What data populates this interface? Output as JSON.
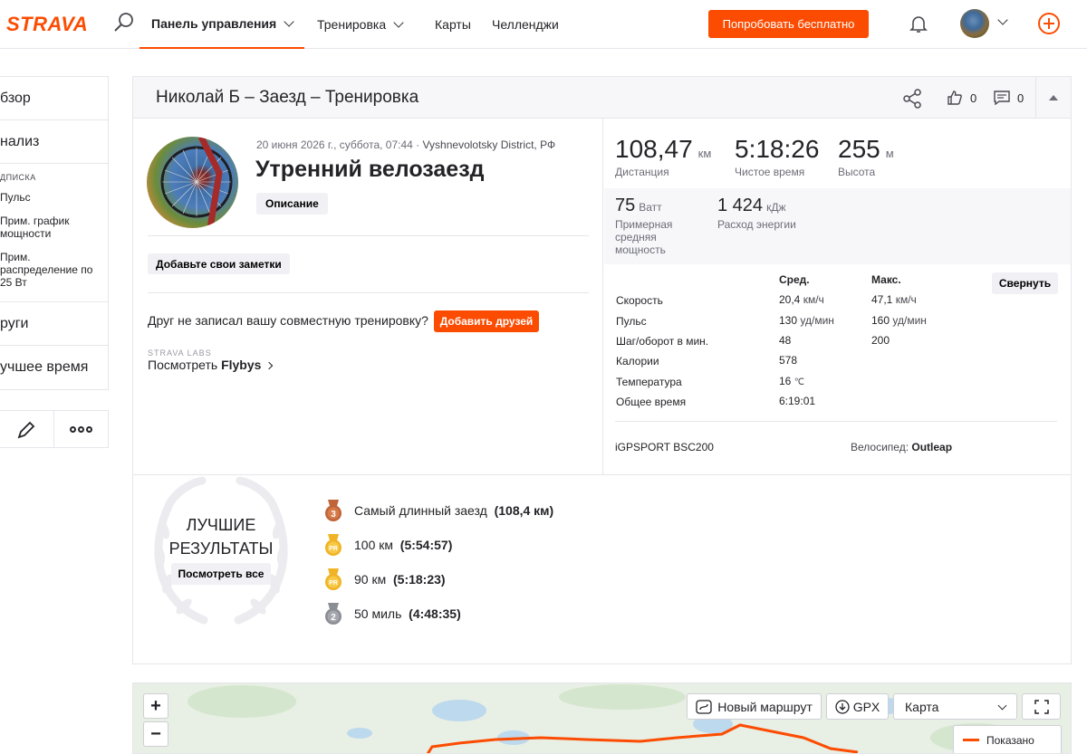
{
  "topbar": {
    "logo": "STRAVA",
    "nav": {
      "dashboard": "Панель управления",
      "training": "Тренировка",
      "maps": "Карты",
      "challenges": "Челленджи"
    },
    "try_free": "Попробовать бесплатно",
    "accent_color": "#fc4c02"
  },
  "sidebar": {
    "overview": "бзор",
    "analysis": "нализ",
    "subscription_header": "ДПИСКА",
    "sub_items": [
      "Пульс",
      "Прим. график мощности",
      "Прим. распределение по 25 Вт"
    ],
    "others": "руги",
    "best_efforts": "учшее время"
  },
  "header": {
    "title": "Николай Б – Заезд – Тренировка",
    "likes": "0",
    "comments": "0"
  },
  "activity": {
    "date_loc": "20 июня 2026 г., суббота, 07:44 · ",
    "location": "Vyshnevolotsky District, РФ",
    "name": "Утренний велозаезд",
    "description_btn": "Описание",
    "notes_btn": "Добавьте свои заметки",
    "friend_question": "Друг не записал вашу совместную тренировку?",
    "add_friends_btn": "Добавить друзей",
    "labs": "STRAVA LABS",
    "flybys_prefix": "Посмотреть ",
    "flybys": "Flybys"
  },
  "stats": {
    "distance": {
      "value": "108,47",
      "unit": "км",
      "label": "Дистанция"
    },
    "moving_time": {
      "value": "5:18:26",
      "label": "Чистое время"
    },
    "elevation": {
      "value": "255",
      "unit": "м",
      "label": "Высота"
    },
    "power": {
      "value": "75",
      "unit": "Ватт",
      "label": "Примерная средняя мощность"
    },
    "energy": {
      "value": "1 424",
      "unit": "кДж",
      "label": "Расход энергии"
    }
  },
  "details": {
    "avg_header": "Сред.",
    "max_header": "Макс.",
    "collapse_btn": "Свернуть",
    "rows": [
      {
        "label": "Скорость",
        "avg": "20,4",
        "avg_unit": "км/ч",
        "max": "47,1",
        "max_unit": "км/ч"
      },
      {
        "label": "Пульс",
        "avg": "130",
        "avg_unit": "уд/мин",
        "max": "160",
        "max_unit": "уд/мин"
      },
      {
        "label": "Шаг/оборот в мин.",
        "avg": "48",
        "avg_unit": "",
        "max": "200",
        "max_unit": ""
      },
      {
        "label": "Калории",
        "avg": "578",
        "avg_unit": "",
        "max": "",
        "max_unit": ""
      },
      {
        "label": "Температура",
        "avg": "16",
        "avg_unit": "℃",
        "max": "",
        "max_unit": ""
      },
      {
        "label": "Общее время",
        "avg": "6:19:01",
        "avg_unit": "",
        "max": "",
        "max_unit": ""
      }
    ],
    "device": "iGPSPORT BSC200",
    "bike_label": "Велосипед: ",
    "bike_name": "Outleap"
  },
  "achievements": {
    "title_line1": "ЛУЧШИЕ",
    "title_line2": "РЕЗУЛЬТАТЫ",
    "see_all": "Посмотреть все",
    "items": [
      {
        "medal": "3",
        "text": "Самый длинный заезд",
        "value": "(108,4 км)",
        "color": "#c0643a"
      },
      {
        "medal": "PR",
        "text": "100 км",
        "value": "(5:54:57)",
        "color": "#f0b323"
      },
      {
        "medal": "PR",
        "text": "90 км",
        "value": "(5:18:23)",
        "color": "#f0b323"
      },
      {
        "medal": "2",
        "text": "50 миль",
        "value": "(4:48:35)",
        "color": "#8a8d93"
      }
    ]
  },
  "map": {
    "zoom_in": "+",
    "zoom_out": "−",
    "new_route": "Новый маршрут",
    "gpx": "GPX",
    "map_type": "Карта",
    "legend": "Показано"
  }
}
